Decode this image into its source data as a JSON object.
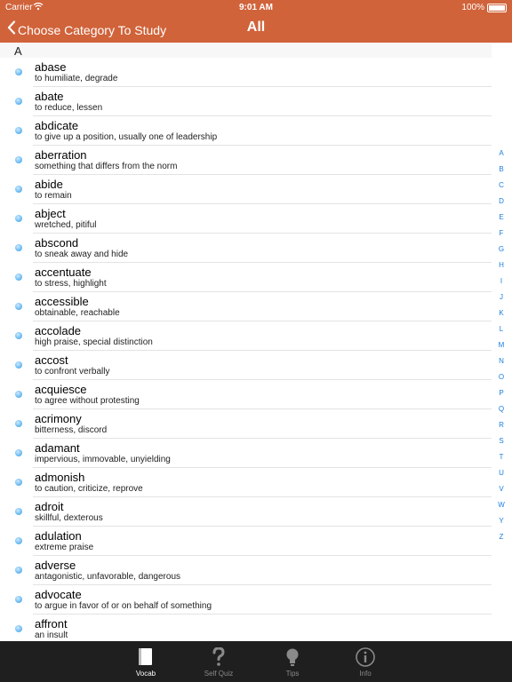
{
  "status": {
    "carrier": "Carrier",
    "time": "9:01 AM",
    "battery": "100%"
  },
  "nav": {
    "back_label": "Choose Category To Study",
    "title": "All"
  },
  "section": {
    "letter": "A"
  },
  "words": [
    {
      "word": "abase",
      "def": "to humiliate, degrade"
    },
    {
      "word": "abate",
      "def": "to reduce, lessen"
    },
    {
      "word": "abdicate",
      "def": "to give up a position, usually one of leadership"
    },
    {
      "word": "aberration",
      "def": "something that differs from the norm"
    },
    {
      "word": "abide",
      "def": "to remain"
    },
    {
      "word": "abject",
      "def": "wretched, pitiful"
    },
    {
      "word": "abscond",
      "def": "to sneak away and hide"
    },
    {
      "word": "accentuate",
      "def": "to stress, highlight"
    },
    {
      "word": "accessible",
      "def": "obtainable, reachable"
    },
    {
      "word": "accolade",
      "def": "high praise, special distinction"
    },
    {
      "word": "accost",
      "def": "to confront verbally"
    },
    {
      "word": "acquiesce",
      "def": "to agree without protesting"
    },
    {
      "word": "acrimony",
      "def": "bitterness, discord"
    },
    {
      "word": "adamant",
      "def": "impervious, immovable, unyielding"
    },
    {
      "word": "admonish",
      "def": "to caution, criticize, reprove"
    },
    {
      "word": "adroit",
      "def": "skillful, dexterous"
    },
    {
      "word": "adulation",
      "def": "extreme praise"
    },
    {
      "word": "adverse",
      "def": "antagonistic, unfavorable, dangerous"
    },
    {
      "word": "advocate",
      "def": "to argue in favor of  or on behalf of something"
    },
    {
      "word": "affront",
      "def": "an insult"
    }
  ],
  "index_letters": [
    "A",
    "B",
    "C",
    "D",
    "E",
    "F",
    "G",
    "H",
    "I",
    "J",
    "K",
    "L",
    "M",
    "N",
    "O",
    "P",
    "Q",
    "R",
    "S",
    "T",
    "U",
    "V",
    "W",
    "Y",
    "Z"
  ],
  "tabs": [
    {
      "label": "Vocab",
      "icon": "book-icon",
      "active": true
    },
    {
      "label": "Self Quiz",
      "icon": "question-mark-icon",
      "active": false
    },
    {
      "label": "Tips",
      "icon": "lightbulb-icon",
      "active": false
    },
    {
      "label": "Info",
      "icon": "info-icon",
      "active": false
    }
  ],
  "colors": {
    "nav_bg": "#d0633a",
    "tabbar_bg": "#1f1f1f",
    "index_blue": "#1a7fe0",
    "bullet_blue": "#2b9be9"
  }
}
